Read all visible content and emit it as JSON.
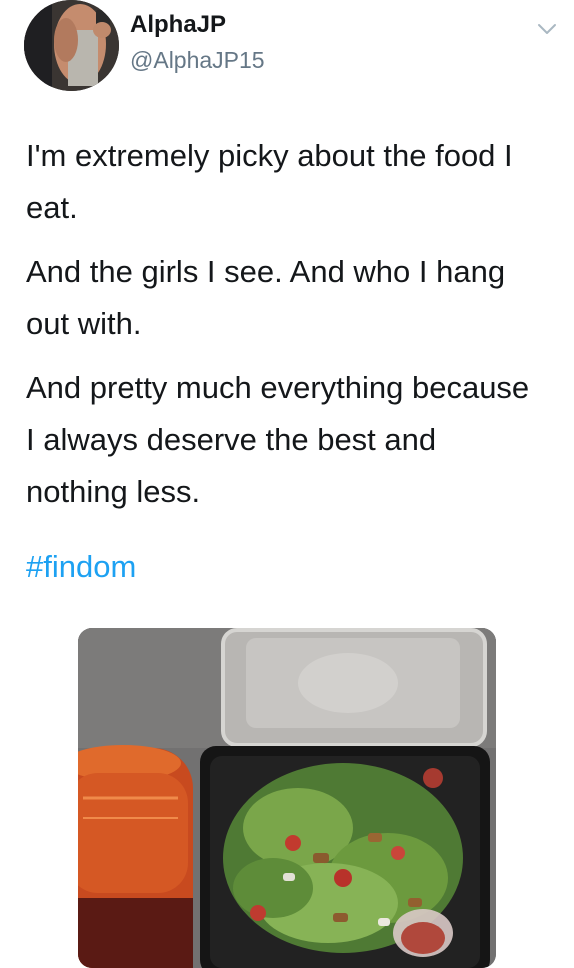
{
  "tweet": {
    "author": {
      "display_name": "AlphaJP",
      "handle": "@AlphaJP15"
    },
    "paragraphs": [
      "I'm extremely picky about the food I eat.",
      "And the girls I see. And who I hang out with.",
      "And pretty much everything because I always deserve the best and nothing less."
    ],
    "hashtag": "#findom",
    "icons": {
      "menu": "chevron-down-icon"
    },
    "colors": {
      "link": "#1da1f2",
      "secondary_text": "#657786",
      "primary_text": "#14171a"
    }
  }
}
